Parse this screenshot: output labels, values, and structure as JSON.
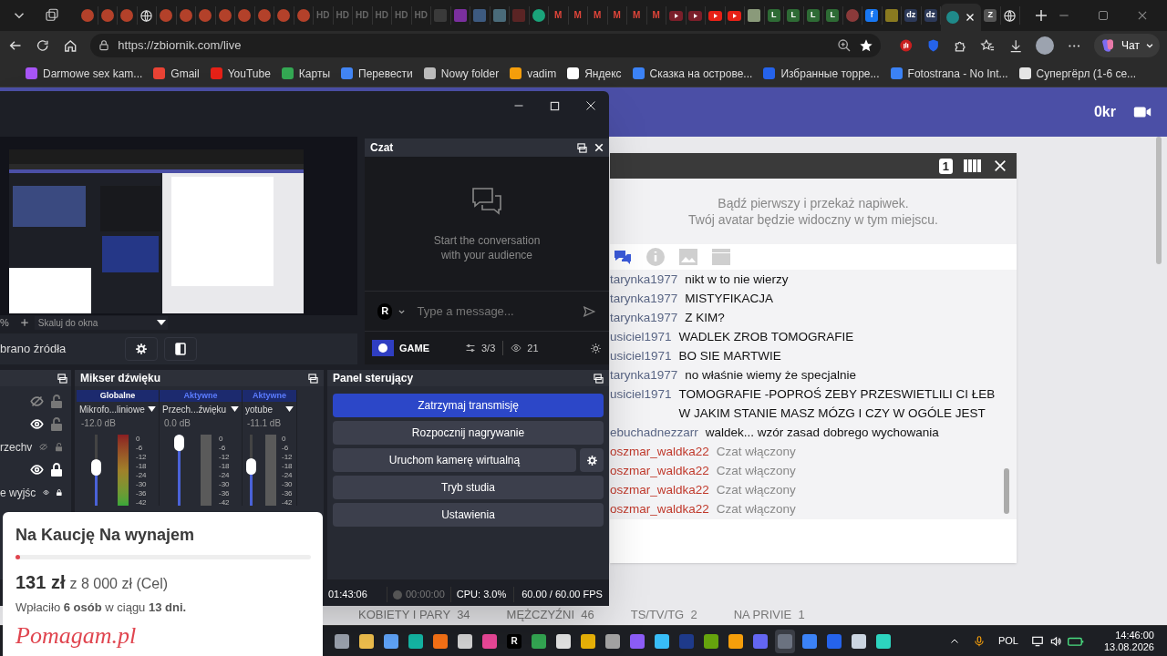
{
  "browser": {
    "tabs": [
      {
        "kind": "dot",
        "color": "#b3412a",
        "selected": false
      },
      {
        "kind": "dot",
        "color": "#b3412a",
        "selected": false
      },
      {
        "kind": "dot",
        "color": "#b3412a",
        "selected": false
      },
      {
        "kind": "globe",
        "selected": false
      },
      {
        "kind": "dot",
        "color": "#b3412a",
        "selected": false
      },
      {
        "kind": "dot",
        "color": "#b3412a",
        "selected": false
      },
      {
        "kind": "dot",
        "color": "#b3412a",
        "selected": false
      },
      {
        "kind": "dot",
        "color": "#b3412a",
        "selected": false
      },
      {
        "kind": "dot",
        "color": "#b3412a",
        "selected": false
      },
      {
        "kind": "dot",
        "color": "#b3412a",
        "selected": false
      },
      {
        "kind": "dot",
        "color": "#b3412a",
        "selected": false
      },
      {
        "kind": "dot",
        "color": "#b3412a",
        "selected": false
      },
      {
        "kind": "text",
        "text": "HD",
        "color": "#666666",
        "selected": false
      },
      {
        "kind": "text",
        "text": "HD",
        "color": "#666666",
        "selected": false
      },
      {
        "kind": "text",
        "text": "HD",
        "color": "#666666",
        "selected": false
      },
      {
        "kind": "text",
        "text": "HD",
        "color": "#666666",
        "selected": false
      },
      {
        "kind": "text",
        "text": "HD",
        "color": "#666666",
        "selected": false
      },
      {
        "kind": "text",
        "text": "HD",
        "color": "#666666",
        "selected": false
      },
      {
        "kind": "tile",
        "color": "#3a3a3a",
        "selected": false
      },
      {
        "kind": "tile",
        "color": "#7a2f9e",
        "selected": false
      },
      {
        "kind": "tile",
        "color": "#3d5a80",
        "selected": false
      },
      {
        "kind": "tile",
        "color": "#4a6b7a",
        "selected": false
      },
      {
        "kind": "tile",
        "color": "#5a2424",
        "selected": false
      },
      {
        "kind": "dot",
        "color": "#1aa37a",
        "selected": false
      },
      {
        "kind": "text",
        "text": "M",
        "color": "#e0453a",
        "selected": false
      },
      {
        "kind": "text",
        "text": "M",
        "color": "#e0453a",
        "selected": false
      },
      {
        "kind": "text",
        "text": "M",
        "color": "#e0453a",
        "selected": false
      },
      {
        "kind": "text",
        "text": "M",
        "color": "#e0453a",
        "selected": false
      },
      {
        "kind": "text",
        "text": "M",
        "color": "#e0453a",
        "selected": false
      },
      {
        "kind": "text",
        "text": "M",
        "color": "#e0453a",
        "selected": false
      },
      {
        "kind": "play",
        "color": "#7a1f2a",
        "selected": false
      },
      {
        "kind": "play",
        "color": "#7a1f2a",
        "selected": false
      },
      {
        "kind": "play",
        "color": "#e62117",
        "selected": false
      },
      {
        "kind": "play",
        "color": "#e62117",
        "selected": false
      },
      {
        "kind": "tile",
        "color": "#8a9a7a",
        "selected": false
      },
      {
        "kind": "letter",
        "text": "L",
        "color": "#2e6b35",
        "selected": false
      },
      {
        "kind": "letter",
        "text": "L",
        "color": "#2e6b35",
        "selected": false
      },
      {
        "kind": "letter",
        "text": "L",
        "color": "#2e6b35",
        "selected": false
      },
      {
        "kind": "letter",
        "text": "L",
        "color": "#2e6b35",
        "selected": false
      },
      {
        "kind": "dot",
        "color": "#8a3a3a",
        "selected": false
      },
      {
        "kind": "letter",
        "text": "f",
        "color": "#1877f2",
        "selected": false
      },
      {
        "kind": "tile",
        "color": "#8a7a20",
        "selected": false
      },
      {
        "kind": "letter",
        "text": "dz",
        "color": "#2d3a5a",
        "selected": false
      },
      {
        "kind": "letter",
        "text": "dz",
        "color": "#2d3a5a",
        "selected": false
      },
      {
        "kind": "dot",
        "color": "#1f8a8a",
        "selected": true
      },
      {
        "kind": "letter",
        "text": "Z",
        "color": "#555555",
        "selected": false
      },
      {
        "kind": "globe",
        "selected": false
      }
    ],
    "url": "https://zbiornik.com/live",
    "copilot_label": "Чат",
    "bookmarks": [
      {
        "label": "Darmowe sex kam...",
        "color": "#a855f7"
      },
      {
        "label": "Gmail",
        "color": "#ea4335"
      },
      {
        "label": "YouTube",
        "color": "#e62117"
      },
      {
        "label": "Карты",
        "color": "#34a853"
      },
      {
        "label": "Перевести",
        "color": "#4285f4"
      },
      {
        "label": "Nowy folder",
        "color": "#bbbbbb"
      },
      {
        "label": "vadim",
        "color": "#f59e0b"
      },
      {
        "label": "Яндекс",
        "color": "#ffffff"
      },
      {
        "label": "Сказка на острове...",
        "color": "#3b82f6"
      },
      {
        "label": "Избранные торре...",
        "color": "#2563eb"
      },
      {
        "label": "Fotostrana - No Int...",
        "color": "#3b82f6"
      },
      {
        "label": "Супергёрл (1-6 се...",
        "color": "#e5e5e5"
      }
    ]
  },
  "page": {
    "credits": "0kr",
    "widget_badge": "1",
    "tip_lines": [
      "Bądź pierwszy i przekaż napiwek.",
      "Twój avatar będzie widoczny w tym miejscu."
    ],
    "chat_tabs": [
      {
        "kind": "chat",
        "selected": true
      },
      {
        "kind": "info",
        "selected": false
      },
      {
        "kind": "image",
        "selected": false
      },
      {
        "kind": "video",
        "selected": false
      }
    ],
    "messages": [
      {
        "user": "tarynka1977",
        "text": "nikt w to nie wierzy",
        "kind": "user"
      },
      {
        "user": "tarynka1977",
        "text": "MISTYFIKACJA",
        "kind": "user"
      },
      {
        "user": "tarynka1977",
        "text": "Z KIM?",
        "kind": "user"
      },
      {
        "user": "usiciel1971",
        "text": "WADLEK ZROB TOMOGRAFIE",
        "kind": "user"
      },
      {
        "user": "usiciel1971",
        "text": "BO SIE MARTWIE",
        "kind": "user"
      },
      {
        "user": "tarynka1977",
        "text": "no właśnie wiemy że specjalnie",
        "kind": "user"
      },
      {
        "user": "usiciel1971",
        "text": "TOMOGRAFIE -POPROŚ ZEBY PRZESWIETLILI CI ŁEB W JAKIM STANIE MASZ MÓZG I CZY W OGÓLE JEST",
        "kind": "user"
      },
      {
        "user": "ebuchadnezzarr",
        "text": "waldek... wzór zasad dobrego wychowania",
        "kind": "user"
      },
      {
        "user": "oszmar_waldka22",
        "text": "Czat włączony",
        "kind": "system"
      },
      {
        "user": "oszmar_waldka22",
        "text": "Czat włączony",
        "kind": "system"
      },
      {
        "user": "oszmar_waldka22",
        "text": "Czat włączony",
        "kind": "system"
      },
      {
        "user": "oszmar_waldka22",
        "text": "Czat włączony",
        "kind": "system"
      }
    ],
    "categories": [
      {
        "label": "KOBIETY I PARY",
        "count": "34"
      },
      {
        "label": "MĘŻCZYŹNI",
        "count": "46"
      },
      {
        "label": "TS/TV/TG",
        "count": "2"
      },
      {
        "label": "NA PRIVIE",
        "count": "1"
      }
    ]
  },
  "obs": {
    "zoom": "%",
    "scale_mode": "Skaluj do okna",
    "source_label": "brano źródła",
    "chat": {
      "title": "Czat",
      "empty_lines": [
        "Start the conversation",
        "with your audience"
      ],
      "placeholder": "Type a message...",
      "avatar": "R",
      "channel": "GAME",
      "connections": "3/3",
      "viewers": "21"
    },
    "sources": [
      {
        "visible": false,
        "locked": false
      },
      {
        "visible": true,
        "locked": false
      },
      {
        "label": "rzechv",
        "visible": false,
        "locked": false
      },
      {
        "visible": true,
        "locked": true
      },
      {
        "label": "e wyjśc",
        "visible": true,
        "locked": true
      }
    ],
    "mixer": {
      "title": "Mikser dźwięku",
      "channels": [
        {
          "header": "Globalne",
          "name": "Mikrofo...liniowe",
          "volume": "-12.0 dB",
          "level": 0.55,
          "live": true,
          "scale": [
            "0",
            "-6",
            "-12",
            "-18",
            "-24",
            "-30",
            "-36",
            "-42"
          ]
        },
        {
          "header": "Aktywne",
          "name": "Przech...źwięku",
          "volume": "0.0 dB",
          "level": 1,
          "live": false,
          "scale": [
            "0",
            "-6",
            "-12",
            "-18",
            "-24",
            "-30",
            "-36",
            "-42"
          ]
        },
        {
          "header": "Aktywne",
          "name": "yotube",
          "volume": "-11.1 dB",
          "level": 0.56,
          "live": false,
          "scale": [
            "0",
            "-6",
            "-12",
            "-18",
            "-24",
            "-30",
            "-36",
            "-42"
          ]
        }
      ]
    },
    "controls": {
      "title": "Panel sterujący",
      "buttons": [
        {
          "label": "Zatrzymaj transmisję",
          "kind": "primary"
        },
        {
          "label": "Rozpocznij nagrywanie",
          "kind": "normal"
        },
        {
          "label": "Uruchom kamerę wirtualną",
          "kind": "settings"
        },
        {
          "label": "Tryb studia",
          "kind": "normal"
        },
        {
          "label": "Ustawienia",
          "kind": "normal"
        }
      ]
    },
    "status": {
      "stream_time": "01:43:06",
      "recording": false,
      "record_time": "00:00:00",
      "cpu": "CPU: 3.0%",
      "fps": "60.00 / 60.00 FPS"
    }
  },
  "fundraiser": {
    "title": "Na Kaucję Na wynajem",
    "level": 0.015,
    "raised": "131 zł",
    "goal": "z 8 000 zł (Cel)",
    "donors": "Wpłaciło **6 osób** w ciągu **13 dni.**",
    "brand": "Pomagam.pl"
  },
  "taskbar": {
    "apps": [
      {
        "color": "#9ca3af",
        "selected": false
      },
      {
        "color": "#f2c14e",
        "selected": false
      },
      {
        "color": "#60a5fa",
        "selected": false
      },
      {
        "color": "#14b8a6",
        "selected": false
      },
      {
        "color": "#f97316",
        "selected": false
      },
      {
        "color": "#d4d4d4",
        "selected": false
      },
      {
        "color": "#ec4899",
        "selected": false
      },
      {
        "color": "#000000",
        "text": "R",
        "selected": false
      },
      {
        "color": "#34a853",
        "selected": false
      },
      {
        "color": "#e5e5e5",
        "selected": false
      },
      {
        "color": "#eab308",
        "selected": false
      },
      {
        "color": "#a3a3a3",
        "selected": false
      },
      {
        "color": "#8b5cf6",
        "selected": false
      },
      {
        "color": "#38bdf8",
        "selected": false
      },
      {
        "color": "#1e3a8a",
        "selected": false
      },
      {
        "color": "#65a30d",
        "selected": false
      },
      {
        "color": "#f59e0b",
        "selected": false
      },
      {
        "color": "#6366f1",
        "selected": false
      },
      {
        "color": "#6b7280",
        "selected": true
      },
      {
        "color": "#3b82f6",
        "selected": false
      },
      {
        "color": "#2563eb",
        "selected": false
      },
      {
        "color": "#cbd5e1",
        "selected": false
      },
      {
        "color": "#2dd4bf",
        "selected": false
      }
    ],
    "language": "POL",
    "time": "14:46:00",
    "date": "13.08.2026"
  }
}
